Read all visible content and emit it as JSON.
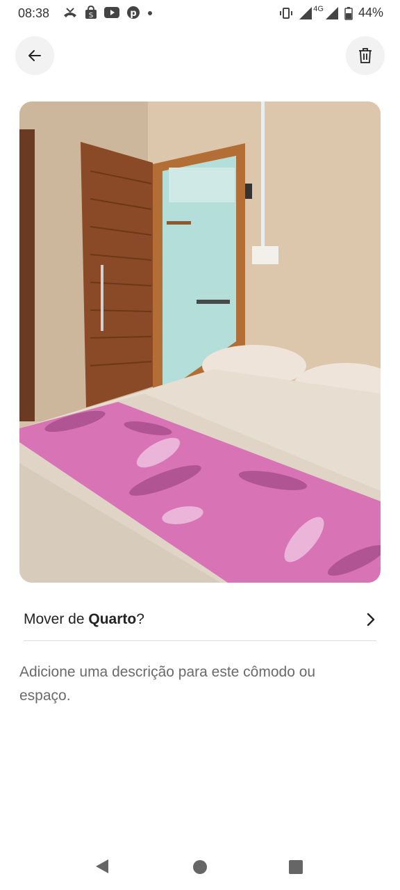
{
  "status_bar": {
    "time": "08:38",
    "network": "4G",
    "battery": "44%",
    "left_icons": [
      "missed-call-icon",
      "shopee-icon",
      "youtube-icon",
      "pinterest-icon",
      "dot-icon"
    ],
    "right_icons": [
      "vibrate-icon",
      "signal-icon",
      "signal-icon",
      "battery-icon"
    ]
  },
  "header": {
    "back_icon": "arrow-left-icon",
    "delete_icon": "trash-icon"
  },
  "photo": {
    "subject": "bedroom-photo"
  },
  "move_row": {
    "prefix": "Mover de ",
    "room": "Quarto",
    "suffix": "?",
    "chevron_icon": "chevron-right-icon"
  },
  "description_placeholder": "Adicione uma descrição para este cômodo ou espaço.",
  "nav_bar": {
    "back_icon": "nav-back-icon",
    "home_icon": "nav-home-icon",
    "recents_icon": "nav-recents-icon"
  },
  "colors": {
    "wall": "#d8c4ab",
    "door": "#8a4d28",
    "bathroom": "#b7e0dc",
    "sheet": "#e7ddd0",
    "blanket": "#d874b6"
  }
}
